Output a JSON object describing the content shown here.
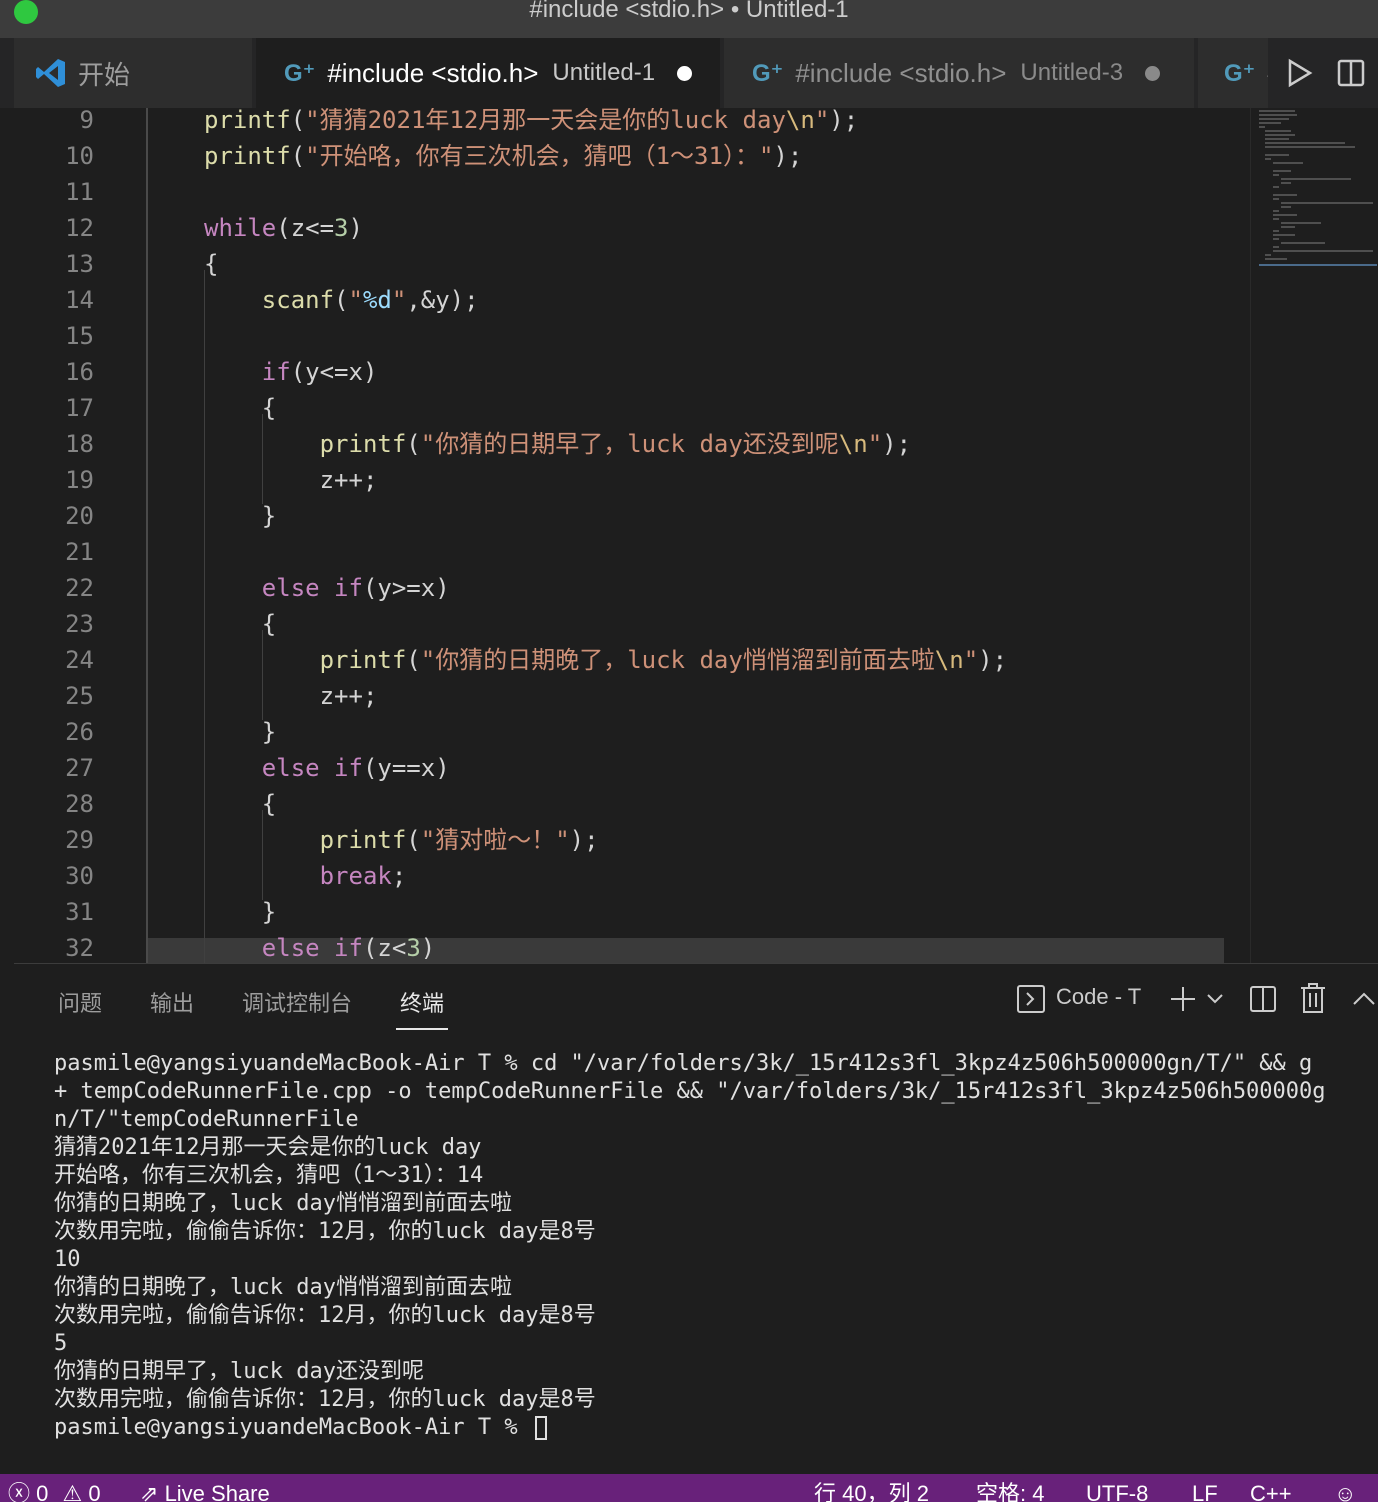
{
  "window": {
    "title": "#include <stdio.h> • Untitled-1"
  },
  "tabs": [
    {
      "label": "开始"
    },
    {
      "label": "#include <stdio.h>",
      "sub": "Untitled-1",
      "modified": true
    },
    {
      "label": "#include <stdio.h>",
      "sub": "Untitled-3",
      "modified": true
    },
    {
      "label": "#"
    }
  ],
  "editor": {
    "lines": [
      {
        "num": "9",
        "text": "    printf(\"猜猜2021年12月那一天会是你的luck day\\n\");"
      },
      {
        "num": "10",
        "text": "    printf(\"开始咯，你有三次机会，猜吧（1～31）：\");"
      },
      {
        "num": "11",
        "text": ""
      },
      {
        "num": "12",
        "text": "    while(z<=3)"
      },
      {
        "num": "13",
        "text": "    {"
      },
      {
        "num": "14",
        "text": "        scanf(\"%d\",&y);"
      },
      {
        "num": "15",
        "text": ""
      },
      {
        "num": "16",
        "text": "        if(y<=x)"
      },
      {
        "num": "17",
        "text": "        {"
      },
      {
        "num": "18",
        "text": "            printf(\"你猜的日期早了，luck day还没到呢\\n\");"
      },
      {
        "num": "19",
        "text": "            z++;"
      },
      {
        "num": "20",
        "text": "        }"
      },
      {
        "num": "21",
        "text": ""
      },
      {
        "num": "22",
        "text": "        else if(y>=x)"
      },
      {
        "num": "23",
        "text": "        {"
      },
      {
        "num": "24",
        "text": "            printf(\"你猜的日期晚了，luck day悄悄溜到前面去啦\\n\");"
      },
      {
        "num": "25",
        "text": "            z++;"
      },
      {
        "num": "26",
        "text": "        }"
      },
      {
        "num": "27",
        "text": "        else if(y==x)"
      },
      {
        "num": "28",
        "text": "        {"
      },
      {
        "num": "29",
        "text": "            printf(\"猜对啦～！\");"
      },
      {
        "num": "30",
        "text": "            break;"
      },
      {
        "num": "31",
        "text": "        }"
      },
      {
        "num": "32",
        "text": "        else if(z<3)"
      }
    ]
  },
  "panel": {
    "tabs": [
      "问题",
      "输出",
      "调试控制台",
      "终端"
    ],
    "active_tab": "终端",
    "terminal_name": "Code - T",
    "terminal_lines": [
      "pasmile@yangsiyuandeMacBook-Air T % cd \"/var/folders/3k/_15r412s3fl_3kpz4z506h500000gn/T/\" && g",
      "+ tempCodeRunnerFile.cpp -o tempCodeRunnerFile && \"/var/folders/3k/_15r412s3fl_3kpz4z506h500000g",
      "n/T/\"tempCodeRunnerFile",
      "猜猜2021年12月那一天会是你的luck day",
      "开始咯，你有三次机会，猜吧（1～31）：14",
      "你猜的日期晚了，luck day悄悄溜到前面去啦",
      "次数用完啦，偷偷告诉你：12月，你的luck day是8号",
      "10",
      "你猜的日期晚了，luck day悄悄溜到前面去啦",
      "次数用完啦，偷偷告诉你：12月，你的luck day是8号",
      "5",
      "你猜的日期早了，luck day还没到呢",
      "次数用完啦，偷偷告诉你：12月，你的luck day是8号"
    ],
    "prompt": "pasmile@yangsiyuandeMacBook-Air T % "
  },
  "statusbar": {
    "errors": "0",
    "warnings": "0",
    "live_share": "Live Share",
    "position": "行 40，列 2",
    "spaces": "空格: 4",
    "encoding": "UTF-8",
    "eol": "LF",
    "language": "C++"
  },
  "colors": {
    "statusbar_bg": "#68217a",
    "editor_bg": "#1e1e1e",
    "keyword": "#c586c0",
    "function": "#dcdcaa",
    "string": "#ce9178"
  }
}
